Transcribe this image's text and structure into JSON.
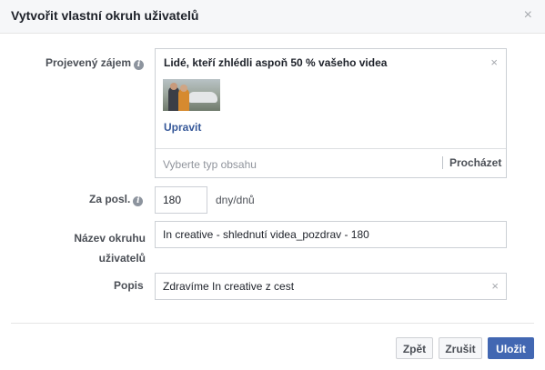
{
  "dialog": {
    "title": "Vytvořit vlastní okruh uživatelů",
    "close_symbol": "×"
  },
  "interest": {
    "label": "Projevený zájem",
    "help_icon": "i",
    "selected_title": "Lidé, kteří zhlédli aspoň 50 % vašeho videa",
    "remove_symbol": "×",
    "edit_link": "Upravit",
    "content_type_placeholder": "Vyberte typ obsahu",
    "browse_label": "Procházet"
  },
  "retention": {
    "label": "Za posl.",
    "help_icon": "i",
    "value": "180",
    "unit": "dny/dnů"
  },
  "audience_name": {
    "label_line1": "Název okruhu",
    "label_line2": "uživatelů",
    "value": "In creative - shlednutí videa_pozdrav - 180"
  },
  "description": {
    "label": "Popis",
    "value": "Zdravíme In creative z cest",
    "clear_symbol": "×"
  },
  "footer": {
    "back_label": "Zpět",
    "cancel_label": "Zrušit",
    "save_label": "Uložit"
  },
  "colors": {
    "primary_button": "#4267b2",
    "link": "#365899",
    "header_bg": "#f6f7f9"
  }
}
